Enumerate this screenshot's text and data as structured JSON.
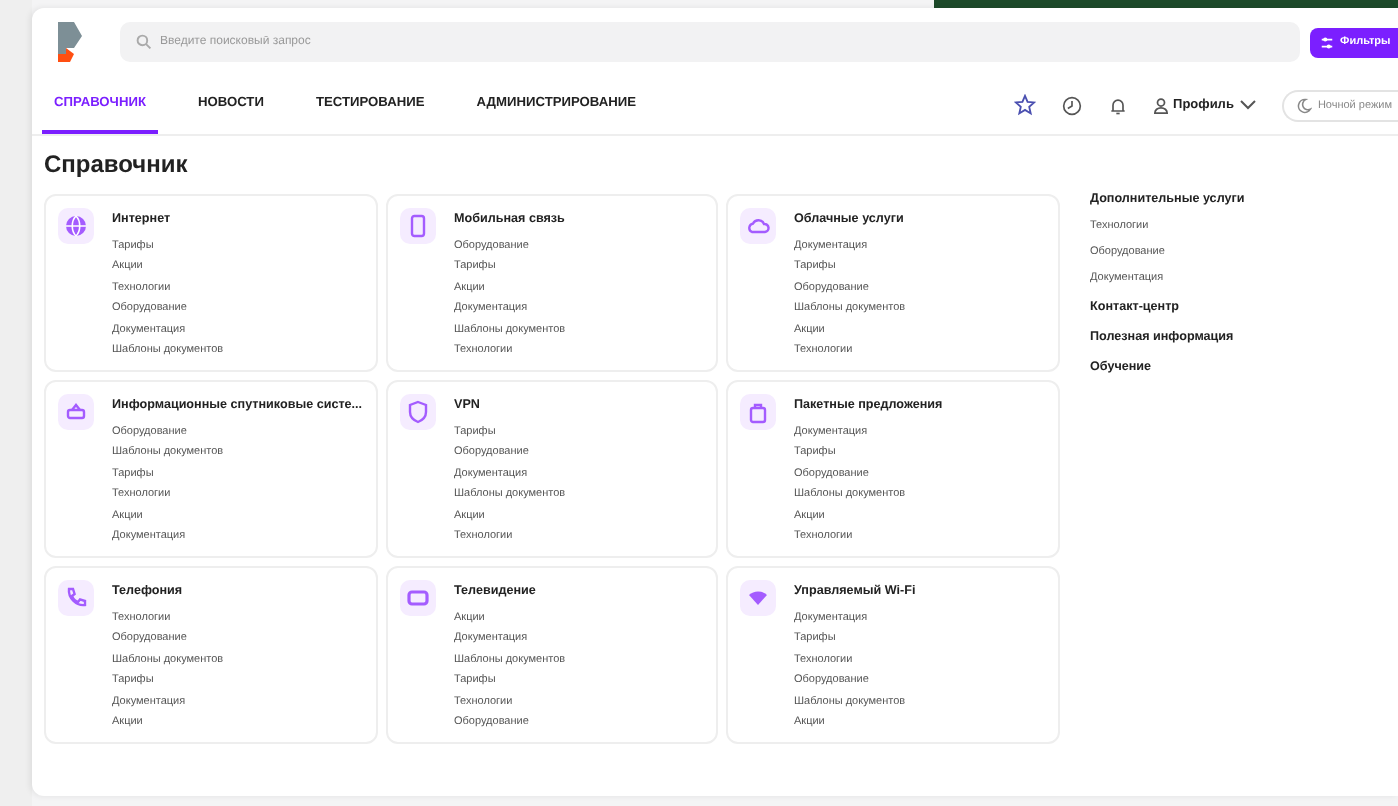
{
  "search": {
    "placeholder": "Введите поисковый запрос"
  },
  "filter_button": "Фильтры",
  "tabs": [
    {
      "label": "СПРАВОЧНИК",
      "selected": true
    },
    {
      "label": "НОВОСТИ",
      "selected": false
    },
    {
      "label": "ТЕСТИРОВАНИЕ",
      "selected": false
    },
    {
      "label": "АДМИНИСТРИРОВАНИЕ",
      "selected": false
    }
  ],
  "profile": "Профиль",
  "night_mode": {
    "label": "Ночной режим",
    "on": false
  },
  "page_title": "Справочник",
  "cards": [
    {
      "title": "Интернет",
      "items": [
        "Тарифы",
        "Акции",
        "Технологии",
        "Оборудование",
        "Документация",
        "Шаблоны документов"
      ]
    },
    {
      "title": "Мобильная связь",
      "items": [
        "Оборудование",
        "Тарифы",
        "Акции",
        "Документация",
        "Шаблоны документов",
        "Технологии"
      ]
    },
    {
      "title": "Облачные услуги",
      "items": [
        "Документация",
        "Тарифы",
        "Оборудование",
        "Шаблоны документов",
        "Акции",
        "Технологии"
      ]
    },
    {
      "title": "Информационные спутниковые систе...",
      "items": [
        "Оборудование",
        "Шаблоны документов",
        "Тарифы",
        "Технологии",
        "Акции",
        "Документация"
      ]
    },
    {
      "title": "VPN",
      "items": [
        "Тарифы",
        "Оборудование",
        "Документация",
        "Шаблоны документов",
        "Акции",
        "Технологии"
      ]
    },
    {
      "title": "Пакетные предложения",
      "items": [
        "Документация",
        "Тарифы",
        "Оборудование",
        "Шаблоны документов",
        "Акции",
        "Технологии"
      ]
    },
    {
      "title": "Телефония",
      "items": [
        "Технологии",
        "Оборудование",
        "Шаблоны документов",
        "Тарифы",
        "Документация",
        "Акции"
      ]
    },
    {
      "title": "Телевидение",
      "items": [
        "Акции",
        "Документация",
        "Шаблоны документов",
        "Тарифы",
        "Технологии",
        "Оборудование"
      ]
    },
    {
      "title": "Управляемый Wi-Fi",
      "items": [
        "Документация",
        "Тарифы",
        "Технологии",
        "Оборудование",
        "Шаблоны документов",
        "Акции"
      ]
    }
  ],
  "sidebar": [
    {
      "title": "Дополнительные услуги",
      "items": [
        "Технологии",
        "Оборудование",
        "Документация"
      ]
    },
    {
      "title": "Контакт-центр"
    },
    {
      "title": "Полезная информация"
    },
    {
      "title": "Обучение"
    }
  ]
}
